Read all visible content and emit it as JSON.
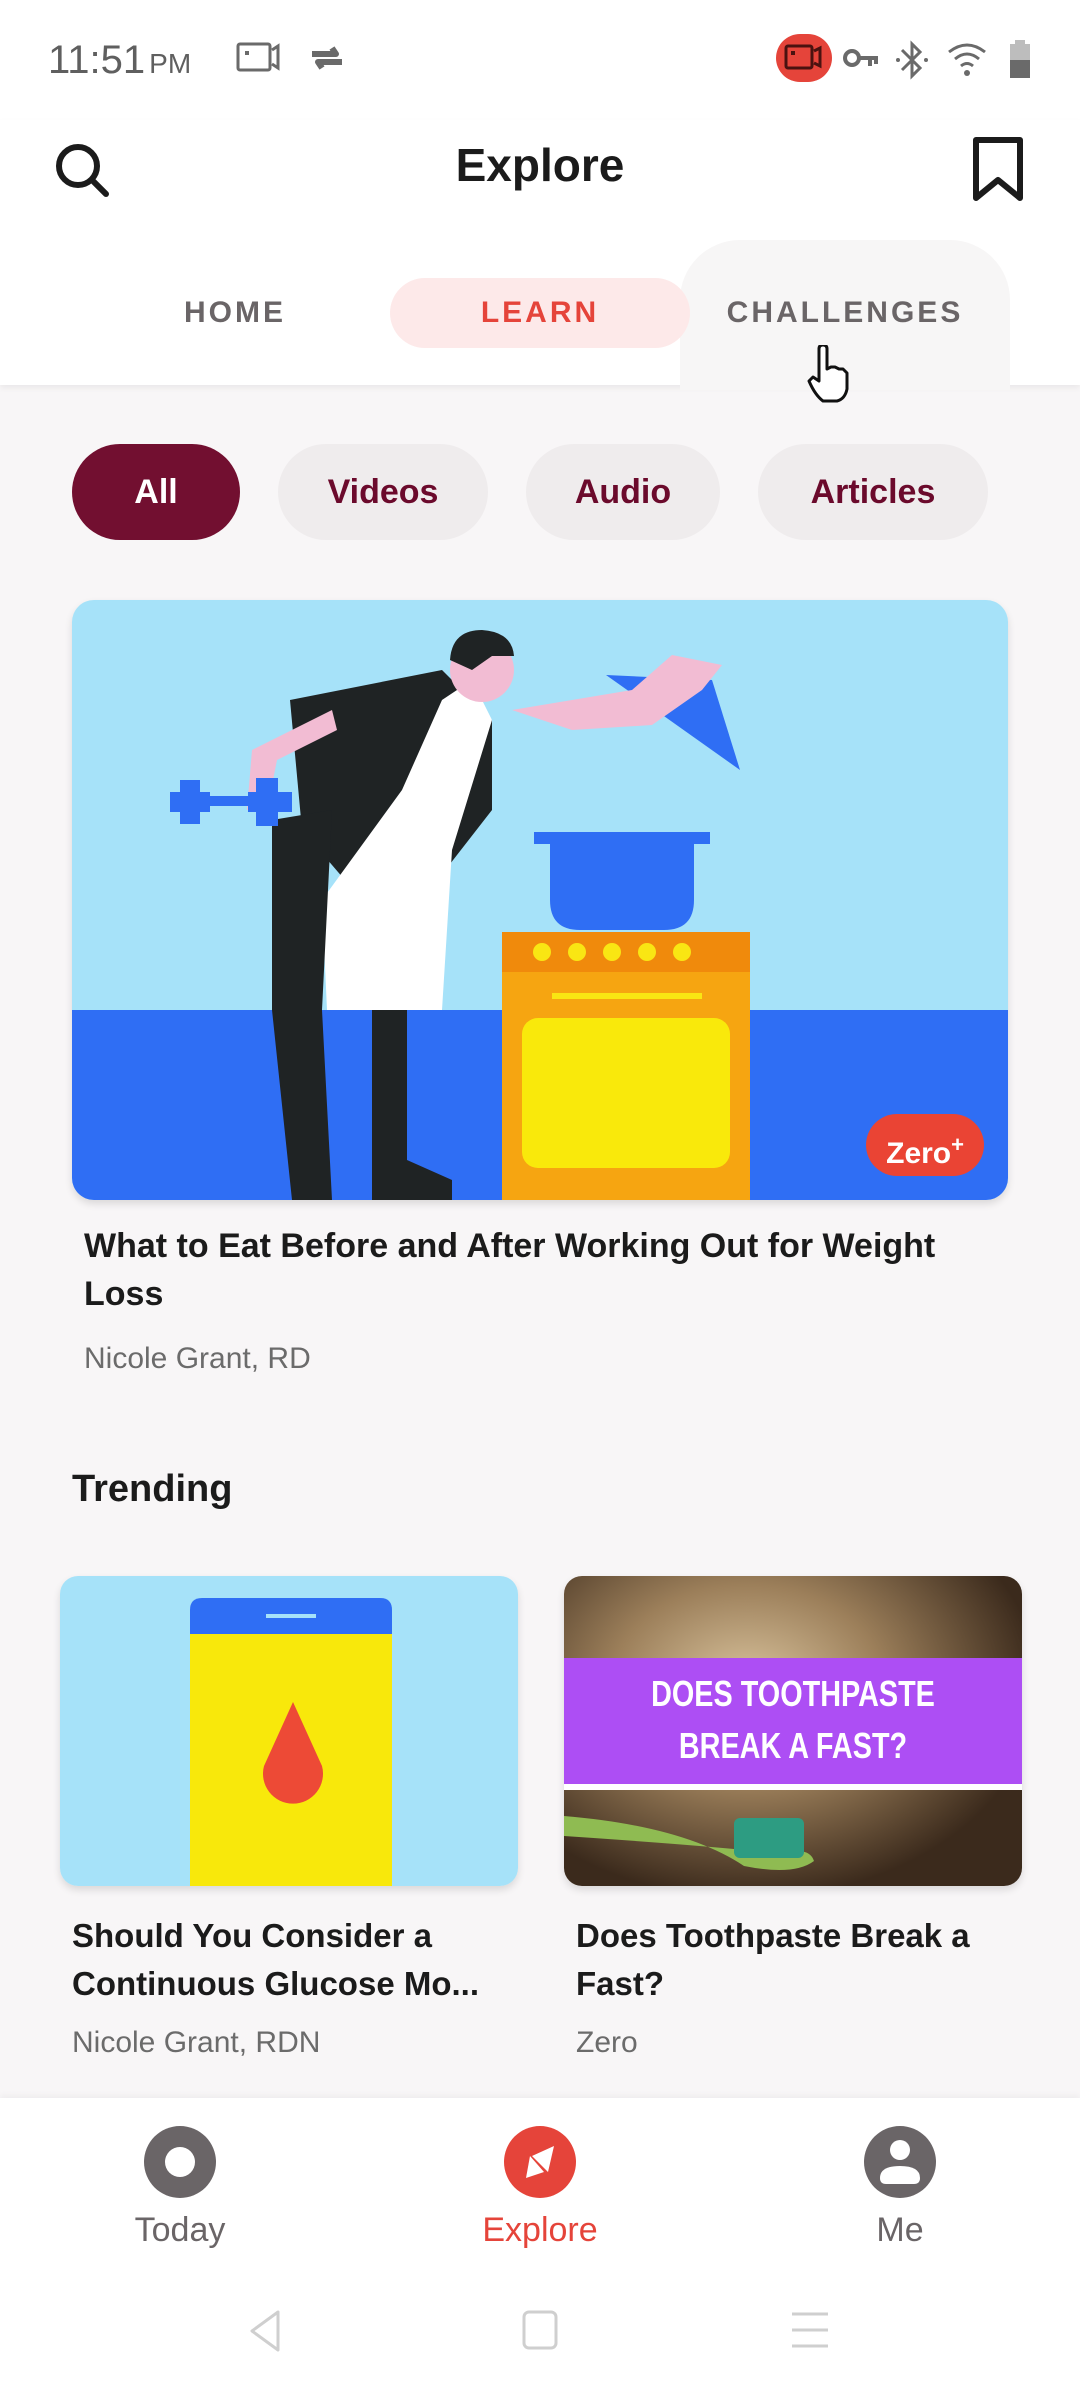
{
  "status_bar": {
    "time": "11:51",
    "ampm": "PM",
    "left_icons": [
      "screen-record-icon",
      "sync-icon"
    ],
    "right_icons": [
      "camera-recording-icon",
      "vpn-key-icon",
      "bluetooth-icon",
      "wifi-icon",
      "battery-icon"
    ]
  },
  "header": {
    "title": "Explore",
    "search_icon": "search-icon",
    "bookmark_icon": "bookmark-icon"
  },
  "tabs": [
    {
      "label": "HOME",
      "active": false
    },
    {
      "label": "LEARN",
      "active": true
    },
    {
      "label": "CHALLENGES",
      "active": false
    }
  ],
  "filters": [
    {
      "label": "All",
      "active": true
    },
    {
      "label": "Videos",
      "active": false
    },
    {
      "label": "Audio",
      "active": false
    },
    {
      "label": "Articles",
      "active": false
    }
  ],
  "featured": {
    "title": "What to Eat Before and After Working Out for Weight Loss",
    "author": "Nicole Grant, RD",
    "badge": "Zero",
    "badge_sup": "+"
  },
  "trending": {
    "section_title": "Trending",
    "items": [
      {
        "title": "Should You Consider a Continuous Glucose Mo...",
        "author": "Nicole Grant, RDN"
      },
      {
        "title": "Does Toothpaste Break a Fast?",
        "author": "Zero",
        "image_text_line1": "DOES TOOTHPASTE",
        "image_text_line2": "BREAK A FAST?"
      }
    ]
  },
  "bottom_nav": [
    {
      "label": "Today",
      "active": false
    },
    {
      "label": "Explore",
      "active": true
    },
    {
      "label": "Me",
      "active": false
    }
  ],
  "colors": {
    "accent_red": "#e5443a",
    "chip_active": "#720f30",
    "chip_text": "#6b0a2c",
    "tab_active_bg": "#fde9e9"
  }
}
